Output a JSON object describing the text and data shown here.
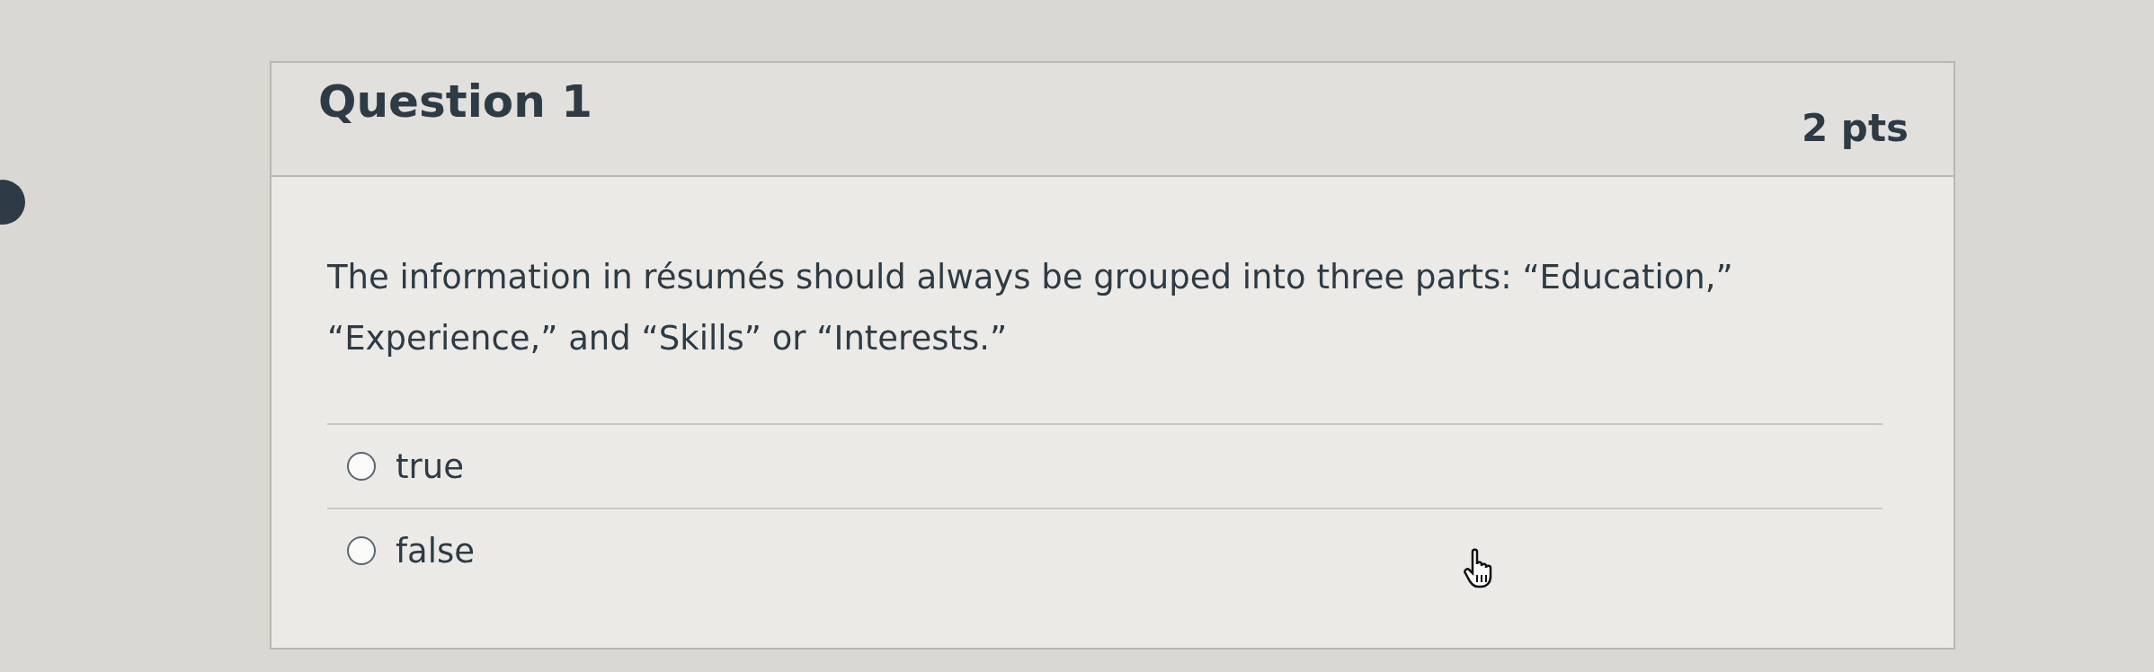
{
  "question": {
    "title": "Question 1",
    "points": "2 pts",
    "text": "The information in résumés should always be grouped into three parts: “Education,” “Experience,” and “Skills” or “Interests.”",
    "answers": [
      {
        "label": "true",
        "selected": false
      },
      {
        "label": "false",
        "selected": false
      }
    ]
  }
}
